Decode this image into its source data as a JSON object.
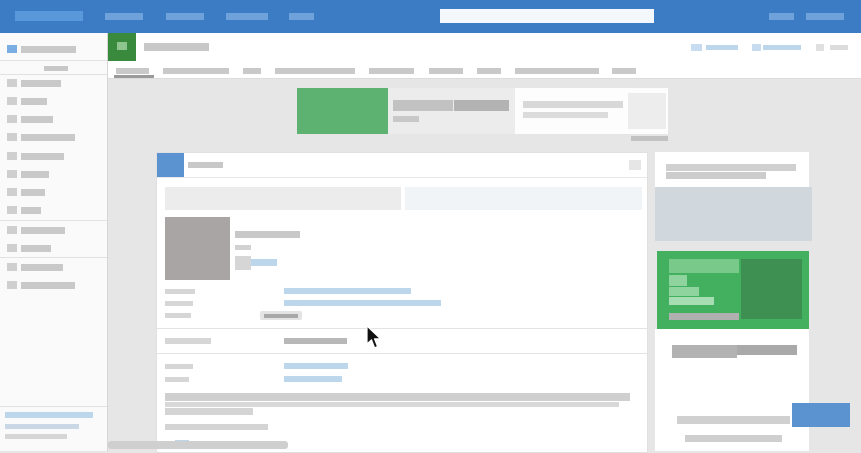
{
  "window": {
    "title": ""
  },
  "top_bar": {
    "search": {
      "placeholder": "",
      "value": ""
    },
    "colors": {
      "bar": "#3b7cc4",
      "placeholder_text": "#6fa2da"
    }
  },
  "header": {
    "app_icon": "app-grid-icon",
    "colors": {
      "icon_bg": "#3a8a3e"
    }
  },
  "main": {
    "card": {
      "colors": {
        "accent": "#5b93d1",
        "link": "#bcd6ec",
        "photo": "#a9a5a5"
      }
    },
    "right_column": {
      "colors": {
        "promo": "#42b05e",
        "promo_dark": "#3d8f52"
      }
    },
    "chat_button": {
      "label": ""
    }
  },
  "icons": {
    "cursor": "mouse-pointer-icon",
    "bookmark": "bookmark-icon",
    "share": "share-icon",
    "more": "more-icon"
  }
}
